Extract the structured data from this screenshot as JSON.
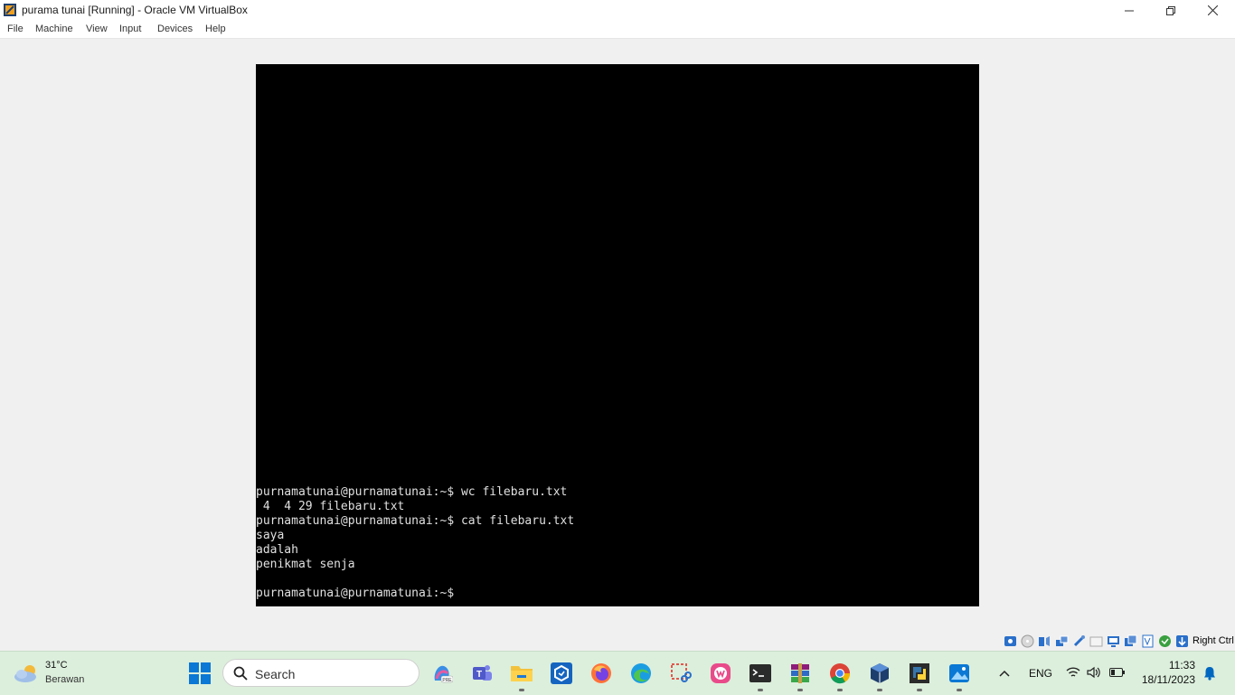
{
  "window": {
    "title": "purama tunai [Running] - Oracle VM VirtualBox",
    "icon": "virtualbox-icon"
  },
  "menu": {
    "items": [
      "File",
      "Machine",
      "View",
      "Input",
      "Devices",
      "Help"
    ]
  },
  "terminal": {
    "lines": [
      "purnamatunai@purnamatunai:~$ wc filebaru.txt",
      " 4  4 29 filebaru.txt",
      "purnamatunai@purnamatunai:~$ cat filebaru.txt",
      "saya",
      "adalah",
      "penikmat senja",
      "",
      "purnamatunai@purnamatunai:~$"
    ]
  },
  "statusbar": {
    "host_key": "Right Ctrl",
    "icons": [
      "hard-disk-icon",
      "optical-drive-icon",
      "audio-icon",
      "network-icon",
      "usb-icon",
      "shared-folders-icon",
      "display-icon",
      "recording-icon",
      "cpu-icon",
      "mouse-integration-icon",
      "keyboard-capture-icon"
    ]
  },
  "taskbar": {
    "weather": {
      "temp": "31°C",
      "desc": "Berawan"
    },
    "search_placeholder": "Search",
    "apps": [
      "copilot-icon",
      "teams-icon",
      "file-explorer-icon",
      "devtools-icon",
      "firefox-icon",
      "edge-icon",
      "snipping-tool-icon",
      "wps-office-icon",
      "terminal-icon",
      "winrar-icon",
      "chrome-icon",
      "virtualbox-icon",
      "python-icon",
      "photos-icon"
    ],
    "tray": {
      "lang": "ENG",
      "time": "11:33",
      "date": "18/11/2023"
    }
  },
  "colors": {
    "accent": "#0067c0",
    "taskbar": "#dcefdc",
    "vm_bg": "#000000"
  }
}
